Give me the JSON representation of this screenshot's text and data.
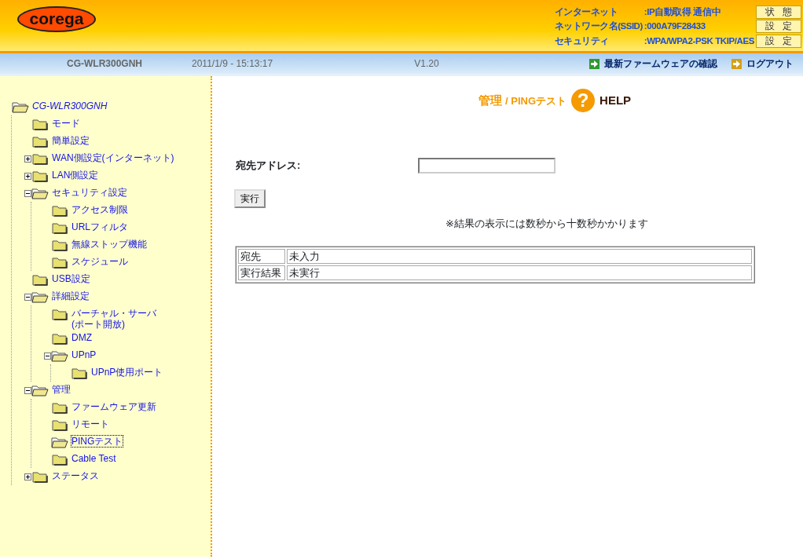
{
  "header": {
    "logo": "corega",
    "status": [
      {
        "label": "インターネット",
        "value": ":IP自動取得 通信中",
        "button": "状態"
      },
      {
        "label": "ネットワーク名(SSID)",
        "value": ":000A79F28433",
        "button": "設定"
      },
      {
        "label": "セキュリティ",
        "value": ":WPA/WPA2-PSK TKIP/AES",
        "button": "設定"
      }
    ]
  },
  "infobar": {
    "model": "CG-WLR300GNH",
    "datetime": "2011/1/9 - 15:13:17",
    "version": "V1.20",
    "links": [
      {
        "label": "最新ファームウェアの確認",
        "color": "#2e9a2e"
      },
      {
        "label": "ログアウト",
        "color": "#d4a017"
      }
    ]
  },
  "sidebar": {
    "tree": [
      {
        "label": "CG-WLR300GNH",
        "selected": false,
        "children": [
          {
            "label": "モード",
            "selected": false
          },
          {
            "label": "簡単設定",
            "selected": false
          },
          {
            "label": "WAN側設定(インターネット)",
            "expanded": false,
            "selected": false
          },
          {
            "label": "LAN側設定",
            "expanded": false,
            "selected": false
          },
          {
            "label": "セキュリティ設定",
            "expanded": true,
            "selected": false,
            "children": [
              {
                "label": "アクセス制限",
                "selected": false
              },
              {
                "label": "URLフィルタ",
                "selected": false
              },
              {
                "label": "無線ストップ機能",
                "selected": false
              },
              {
                "label": "スケジュール",
                "selected": false
              }
            ]
          },
          {
            "label": "USB設定",
            "selected": false
          },
          {
            "label": "詳細設定",
            "expanded": true,
            "selected": false,
            "children": [
              {
                "label": "バーチャル・サーバ\n(ポート開放)",
                "selected": false
              },
              {
                "label": "DMZ",
                "selected": false
              },
              {
                "label": "UPnP",
                "expanded": true,
                "selected": false,
                "children": [
                  {
                    "label": "UPnP使用ポート",
                    "selected": false
                  }
                ]
              }
            ]
          },
          {
            "label": "管理",
            "expanded": true,
            "selected": false,
            "children": [
              {
                "label": "ファームウェア更新",
                "selected": false
              },
              {
                "label": "リモート",
                "selected": false
              },
              {
                "label": "PINGテスト",
                "selected": true
              },
              {
                "label": "Cable Test",
                "selected": false
              }
            ]
          },
          {
            "label": "ステータス",
            "expanded": false,
            "selected": false
          }
        ]
      }
    ]
  },
  "main": {
    "title_section": "管理",
    "title_page": "/ PINGテスト",
    "help_icon": "?",
    "help_label": "HELP",
    "address_label": "宛先アドレス:",
    "run_button": "実行",
    "note": "※結果の表示には数秒から十数秒かかります",
    "results": [
      {
        "label": "宛先",
        "value": "未入力"
      },
      {
        "label": "実行結果",
        "value": "未実行"
      }
    ]
  }
}
